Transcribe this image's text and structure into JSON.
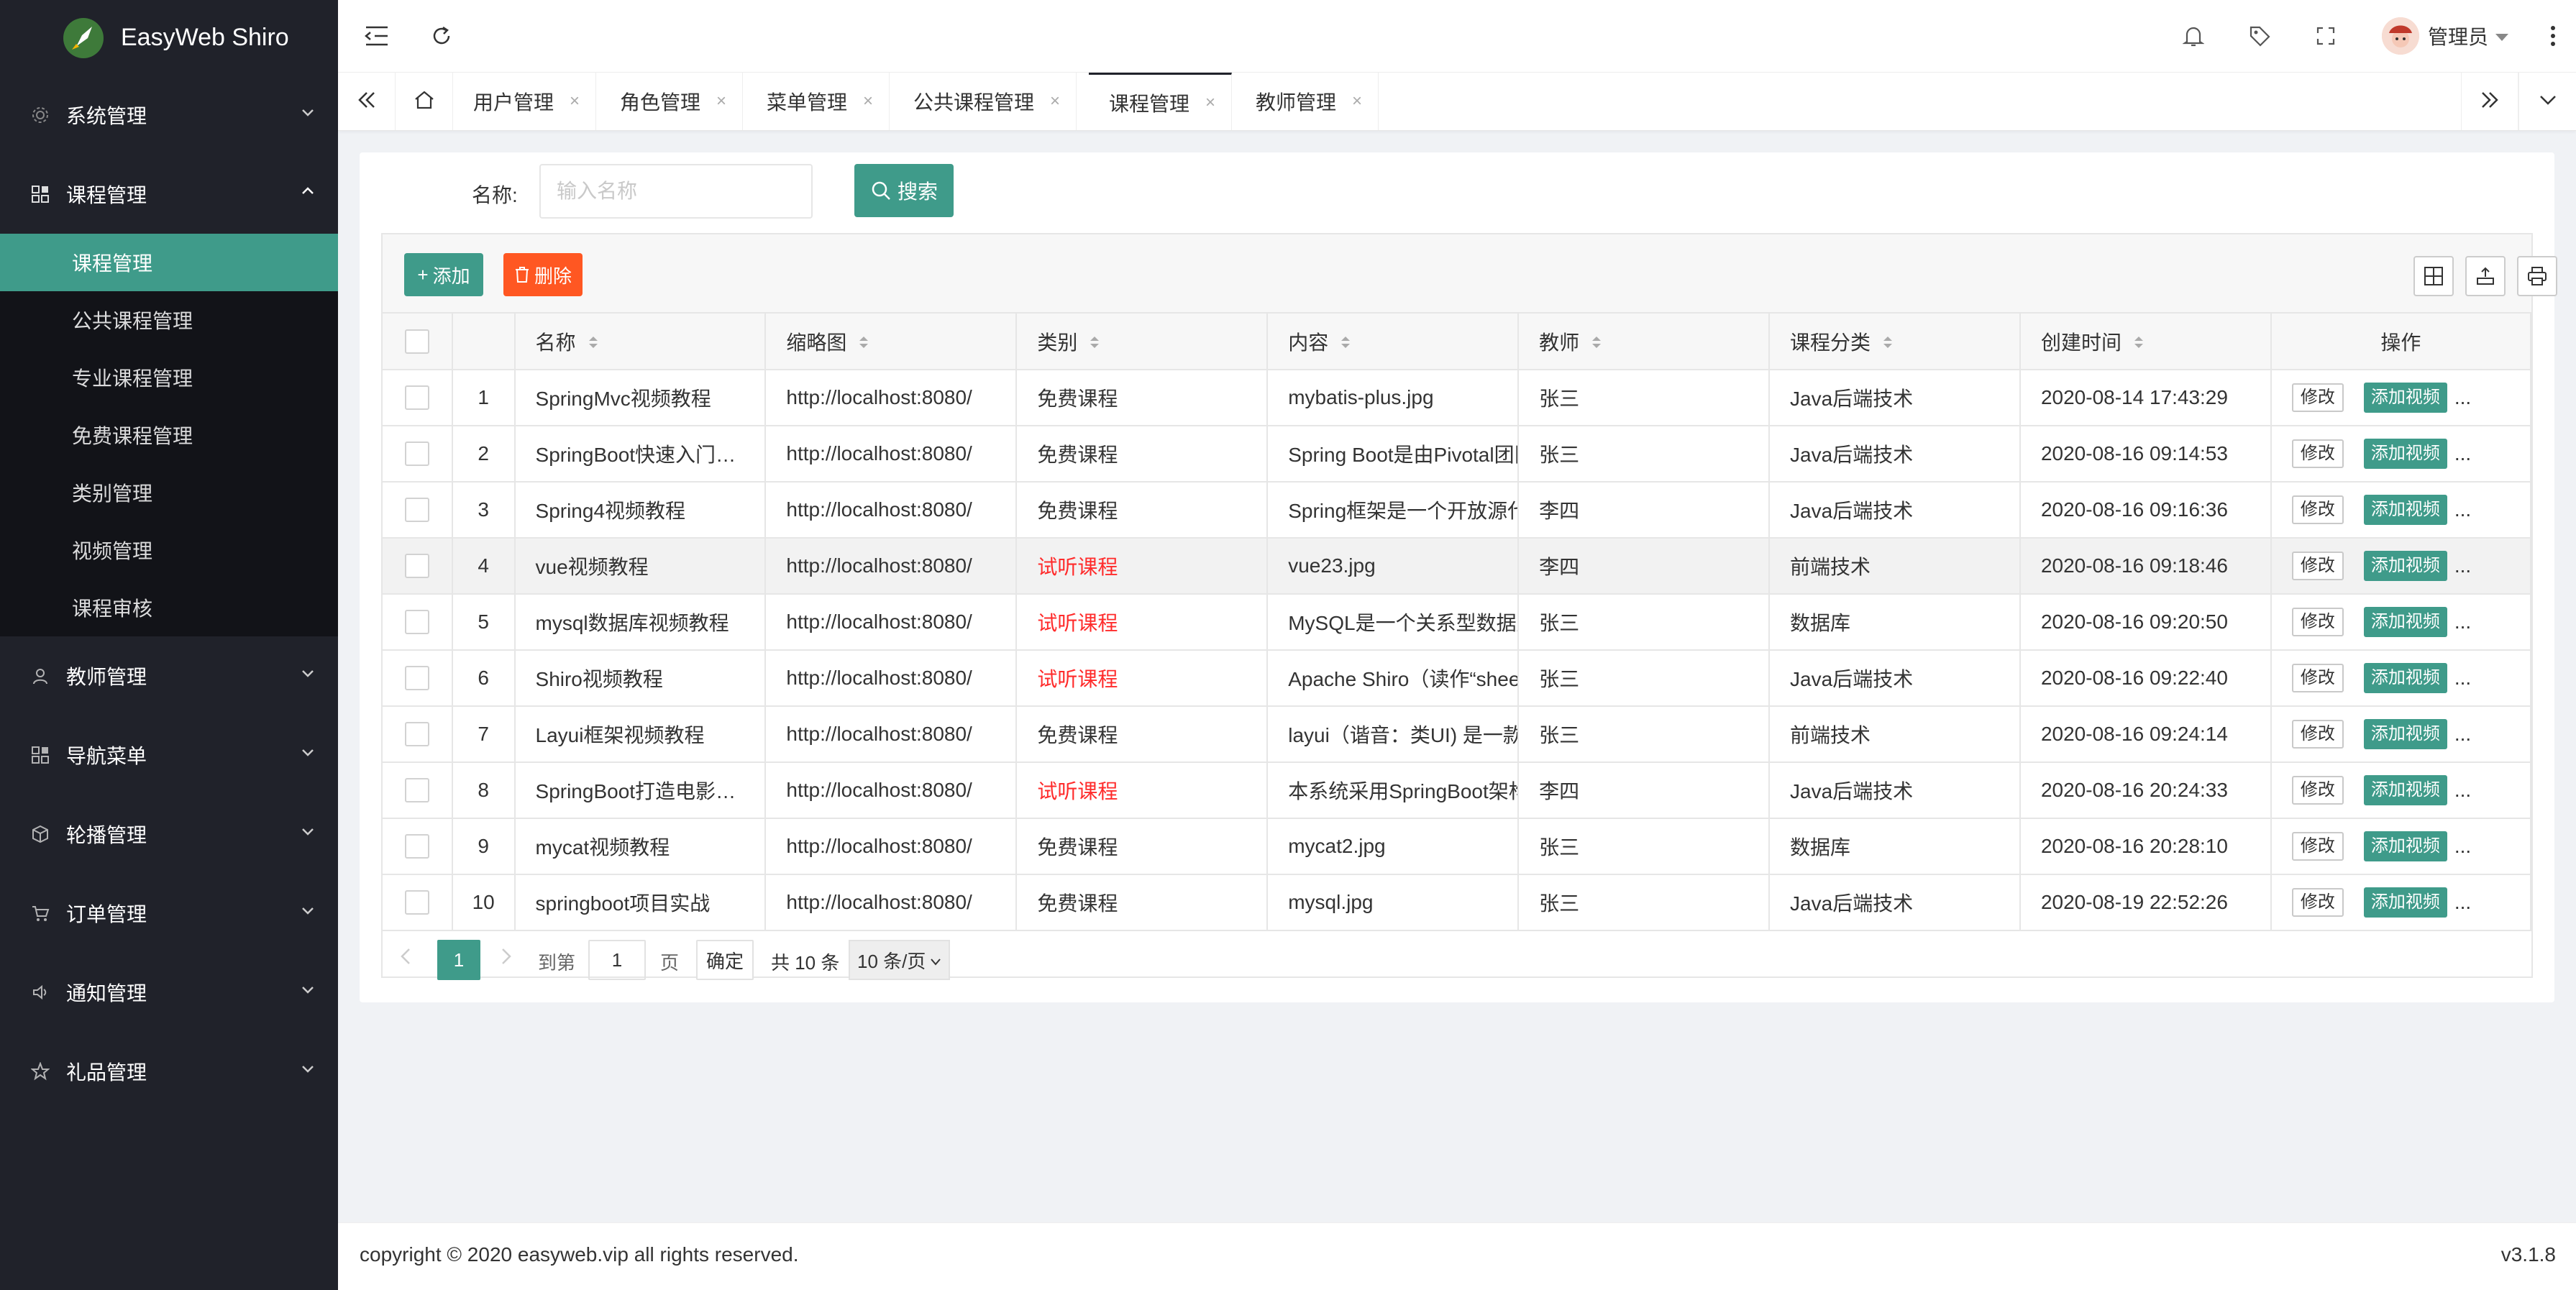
{
  "app": {
    "title": "EasyWeb Shiro"
  },
  "sidebar": {
    "groups": [
      {
        "label": "系统管理",
        "icon": "gear-icon"
      },
      {
        "label": "课程管理",
        "icon": "apps-icon",
        "expanded": true,
        "items": [
          {
            "label": "课程管理",
            "active": true
          },
          {
            "label": "公共课程管理"
          },
          {
            "label": "专业课程管理"
          },
          {
            "label": "免费课程管理"
          },
          {
            "label": "类别管理"
          },
          {
            "label": "视频管理"
          },
          {
            "label": "课程审核"
          }
        ]
      },
      {
        "label": "教师管理",
        "icon": "user-icon"
      },
      {
        "label": "导航菜单",
        "icon": "apps-icon"
      },
      {
        "label": "轮播管理",
        "icon": "cube-icon"
      },
      {
        "label": "订单管理",
        "icon": "cart-icon"
      },
      {
        "label": "通知管理",
        "icon": "speaker-icon"
      },
      {
        "label": "礼品管理",
        "icon": "star-icon"
      }
    ]
  },
  "header": {
    "user_name": "管理员"
  },
  "tabs": [
    {
      "label": "用户管理"
    },
    {
      "label": "角色管理"
    },
    {
      "label": "菜单管理"
    },
    {
      "label": "公共课程管理"
    },
    {
      "label": "课程管理",
      "active": true
    },
    {
      "label": "教师管理"
    }
  ],
  "search": {
    "label": "名称:",
    "placeholder": "输入名称",
    "button": "搜索"
  },
  "toolbar": {
    "add": "添加",
    "delete": "删除"
  },
  "table": {
    "columns": [
      "名称",
      "缩略图",
      "类别",
      "内容",
      "教师",
      "课程分类",
      "创建时间",
      "操作"
    ],
    "rows": [
      {
        "no": "1",
        "name": "SpringMvc视频教程",
        "thumb": "http://localhost:8080/",
        "type": "免费课程",
        "content": "mybatis-plus.jpg",
        "teacher": "张三",
        "category": "Java后端技术",
        "time": "2020-08-14 17:43:29"
      },
      {
        "no": "2",
        "name": "SpringBoot快速入门视频教程",
        "thumb": "http://localhost:8080/",
        "type": "免费课程",
        "content": "Spring Boot是由Pivotal团队",
        "teacher": "张三",
        "category": "Java后端技术",
        "time": "2020-08-16 09:14:53"
      },
      {
        "no": "3",
        "name": "Spring4视频教程",
        "thumb": "http://localhost:8080/",
        "type": "免费课程",
        "content": "Spring框架是一个开放源代码",
        "teacher": "李四",
        "category": "Java后端技术",
        "time": "2020-08-16 09:16:36"
      },
      {
        "no": "4",
        "name": "vue视频教程",
        "thumb": "http://localhost:8080/",
        "type": "试听课程",
        "content": "vue23.jpg",
        "teacher": "李四",
        "category": "前端技术",
        "time": "2020-08-16 09:18:46"
      },
      {
        "no": "5",
        "name": "mysql数据库视频教程",
        "thumb": "http://localhost:8080/",
        "type": "试听课程",
        "content": "MySQL是一个关系型数据库",
        "teacher": "张三",
        "category": "数据库",
        "time": "2020-08-16 09:20:50"
      },
      {
        "no": "6",
        "name": "Shiro视频教程",
        "thumb": "http://localhost:8080/",
        "type": "试听课程",
        "content": "Apache Shiro（读作“shee",
        "teacher": "张三",
        "category": "Java后端技术",
        "time": "2020-08-16 09:22:40"
      },
      {
        "no": "7",
        "name": "Layui框架视频教程",
        "thumb": "http://localhost:8080/",
        "type": "免费课程",
        "content": "layui（谐音：类UI) 是一款",
        "teacher": "张三",
        "category": "前端技术",
        "time": "2020-08-16 09:24:14"
      },
      {
        "no": "8",
        "name": "SpringBoot打造电影网站",
        "thumb": "http://localhost:8080/",
        "type": "试听课程",
        "content": "本系统采用SpringBoot架构",
        "teacher": "李四",
        "category": "Java后端技术",
        "time": "2020-08-16 20:24:33"
      },
      {
        "no": "9",
        "name": "mycat视频教程",
        "thumb": "http://localhost:8080/",
        "type": "免费课程",
        "content": "mycat2.jpg",
        "teacher": "张三",
        "category": "数据库",
        "time": "2020-08-16 20:28:10"
      },
      {
        "no": "10",
        "name": "springboot项目实战",
        "thumb": "http://localhost:8080/",
        "type": "免费课程",
        "content": "mysql.jpg",
        "teacher": "张三",
        "category": "Java后端技术",
        "time": "2020-08-19 22:52:26"
      }
    ],
    "op_edit": "修改",
    "op_video": "添加视频",
    "op_more": "..."
  },
  "pager": {
    "current": "1",
    "goto_label": "到第",
    "goto_value": "1",
    "page_word": "页",
    "ok": "确定",
    "total": "共 10 条",
    "size": "10 条/页"
  },
  "footer": {
    "copyright": "copyright © 2020 easyweb.vip all rights reserved.",
    "version": "v3.1.8"
  },
  "colors": {
    "sidebar": "#20222a",
    "accent": "#3f9b8a",
    "danger": "#ff5722",
    "trial": "#ff2b2b"
  }
}
